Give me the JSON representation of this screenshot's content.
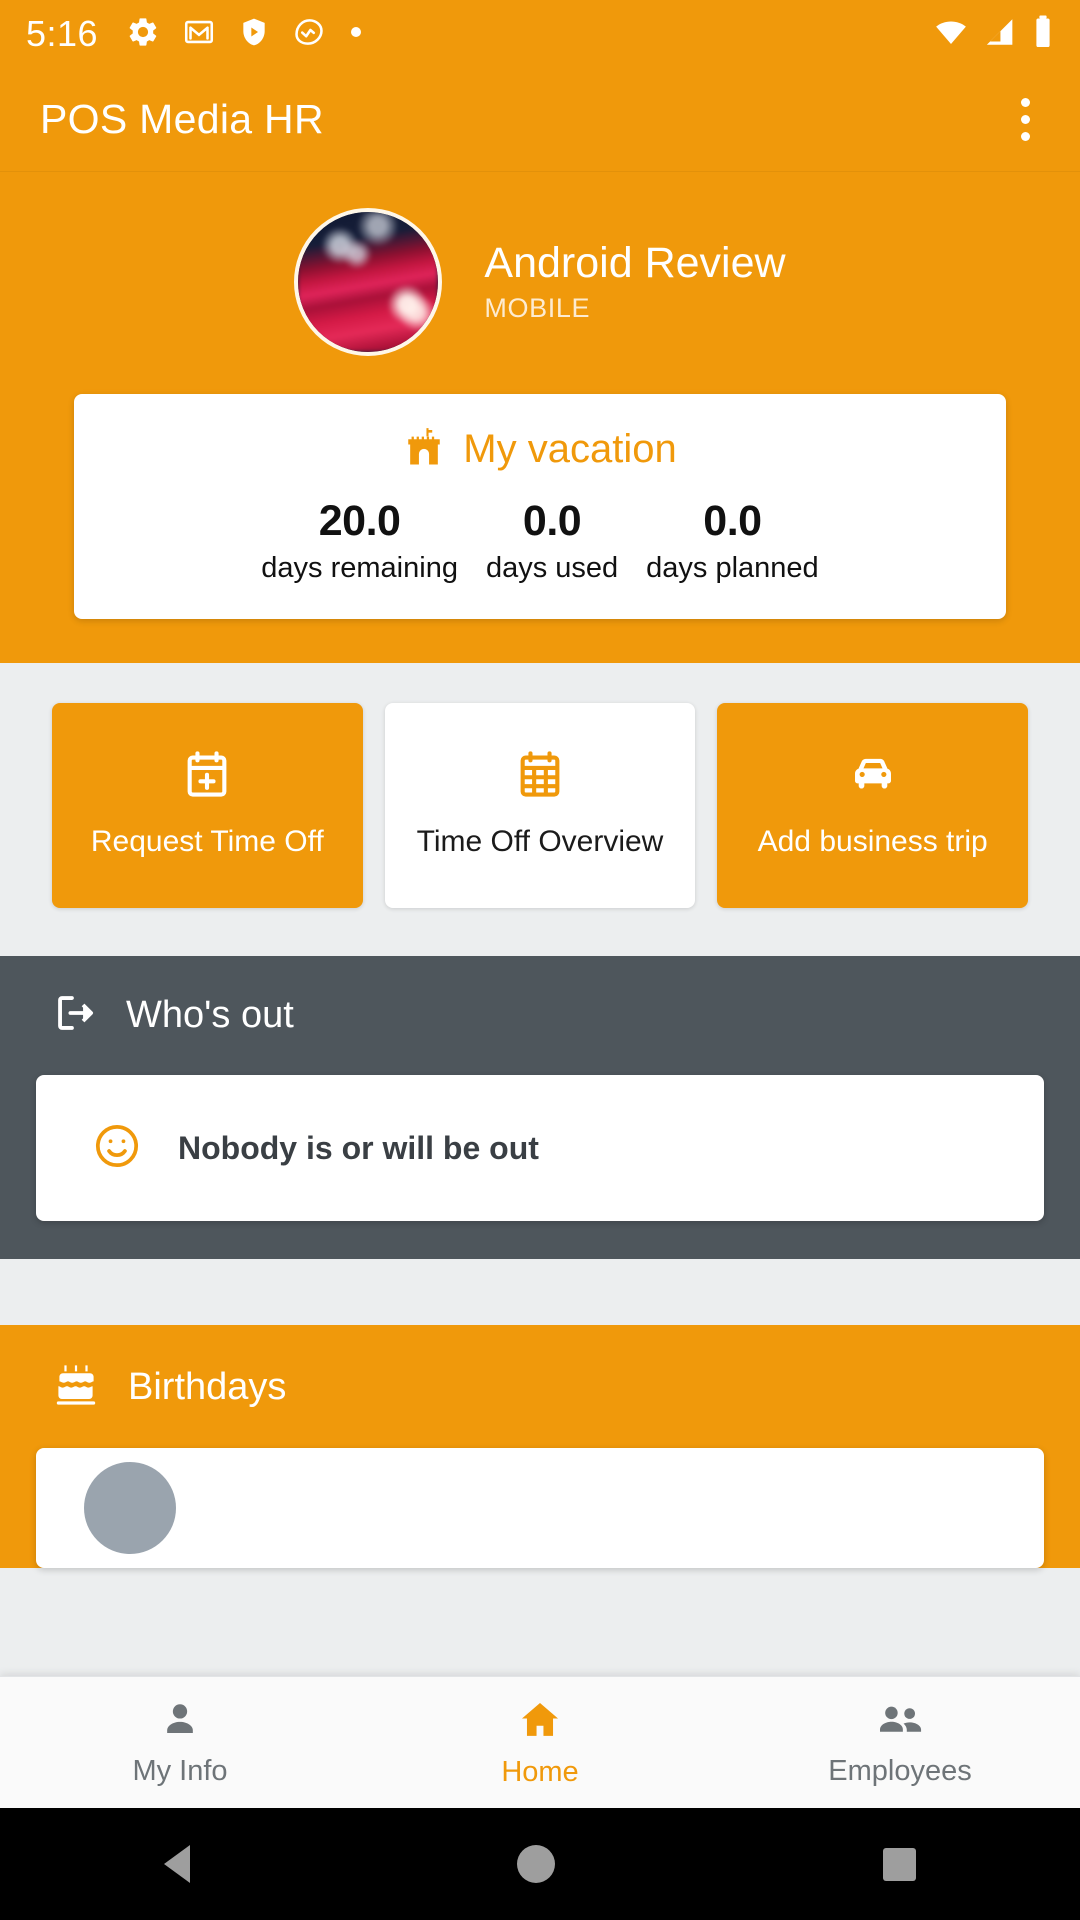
{
  "status_bar": {
    "time": "5:16",
    "left_icons": [
      "gear-icon",
      "gmail-icon",
      "shield-play-icon",
      "activity-icon",
      "dot-icon"
    ],
    "right_icons": [
      "wifi-icon",
      "cell-signal-icon",
      "battery-icon"
    ]
  },
  "app_bar": {
    "title": "POS Media HR",
    "overflow_label": "More options"
  },
  "profile": {
    "name": "Android Review",
    "role": "MOBILE",
    "avatar_alt": "profile-photo"
  },
  "vacation": {
    "title": "My vacation",
    "icon": "castle-icon",
    "stats": [
      {
        "value": "20.0",
        "label": "days remaining"
      },
      {
        "value": "0.0",
        "label": "days used"
      },
      {
        "value": "0.0",
        "label": "days planned"
      }
    ]
  },
  "quick_actions": [
    {
      "label": "Request Time Off",
      "icon": "calendar-plus-icon",
      "style": "filled"
    },
    {
      "label": "Time Off Overview",
      "icon": "calendar-grid-icon",
      "style": "outline"
    },
    {
      "label": "Add business trip",
      "icon": "car-icon",
      "style": "filled"
    }
  ],
  "whos_out": {
    "title": "Who's out",
    "icon": "exit-arrow-icon",
    "empty_message": "Nobody is or will be out",
    "empty_icon": "smiley-icon"
  },
  "birthdays": {
    "title": "Birthdays",
    "icon": "birthday-cake-icon"
  },
  "bottom_nav": [
    {
      "label": "My Info",
      "icon": "person-icon",
      "active": false
    },
    {
      "label": "Home",
      "icon": "home-icon",
      "active": true
    },
    {
      "label": "Employees",
      "icon": "people-icon",
      "active": false
    }
  ],
  "system_nav": {
    "back": "back-button",
    "home": "home-button",
    "recents": "recents-button"
  },
  "colors": {
    "brand_orange": "#F0990B",
    "slate_gray": "#4E565C",
    "page_bg": "#ECEEEF",
    "card_white": "#FFFFFF"
  }
}
